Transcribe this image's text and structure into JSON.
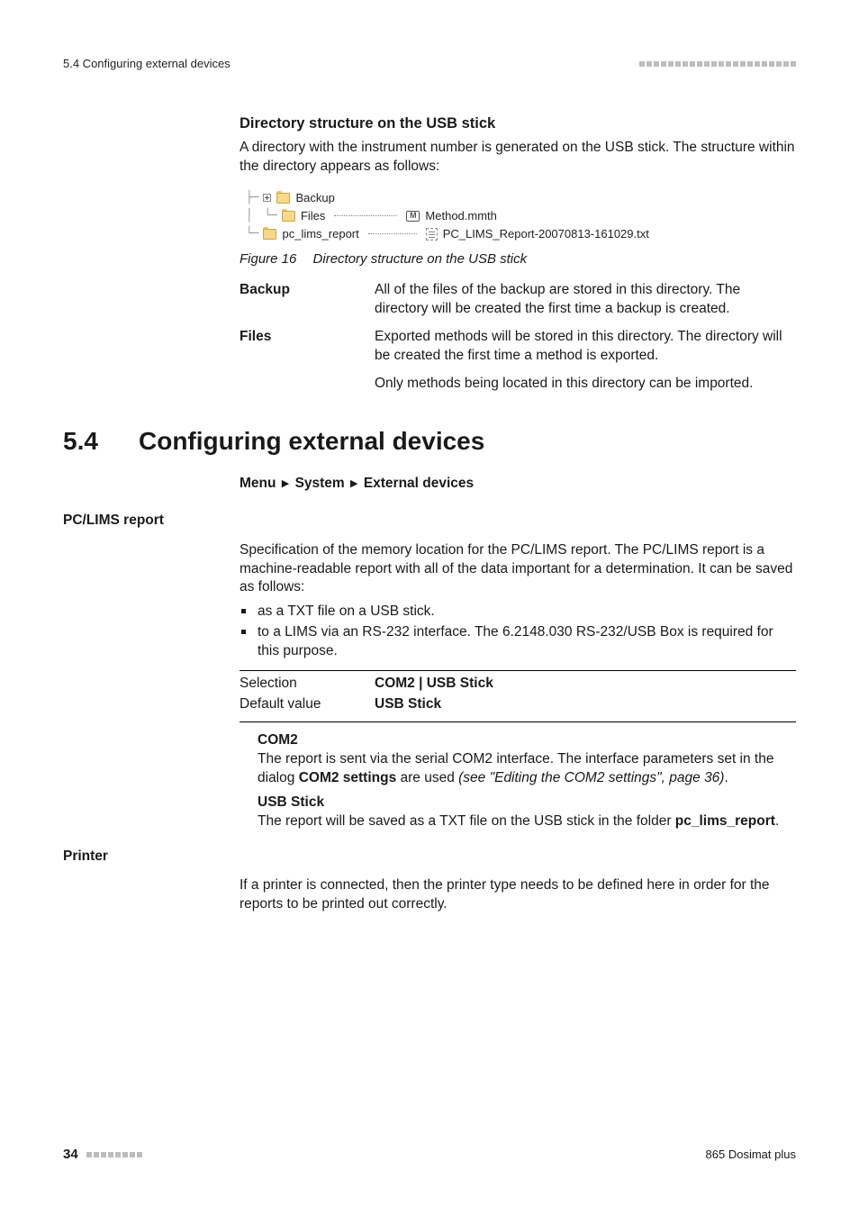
{
  "header": {
    "section_ref": "5.4 Configuring external devices"
  },
  "block1": {
    "heading": "Directory structure on the USB stick",
    "para": "A directory with the instrument number is generated on the USB stick. The structure within the directory appears as follows:",
    "tree": {
      "backup": "Backup",
      "files": "Files",
      "method": "Method.mmth",
      "pclims": "pc_lims_report",
      "report": "PC_LIMS_Report-20070813-161029.txt"
    },
    "fig_label": "Figure 16",
    "fig_caption": "Directory structure on the USB stick",
    "def_backup_term": "Backup",
    "def_backup_body": "All of the files of the backup are stored in this directory. The directory will be created the first time a backup is created.",
    "def_files_term": "Files",
    "def_files_body1": "Exported methods will be stored in this directory. The directory will be created the first time a method is exported.",
    "def_files_body2": "Only methods being located in this directory can be imported."
  },
  "section": {
    "num": "5.4",
    "title": "Configuring external devices"
  },
  "breadcrumb": {
    "a": "Menu",
    "b": "System",
    "c": "External devices"
  },
  "pclims": {
    "label": "PC/LIMS report",
    "para": "Specification of the memory location for the PC/LIMS report. The PC/LIMS report is a machine-readable report with all of the data important for a determination. It can be saved as follows:",
    "li1": "as a TXT file on a USB stick.",
    "li2": "to a LIMS via an RS-232 interface. The 6.2148.030 RS-232/USB Box is required for this purpose.",
    "selection_k": "Selection",
    "selection_v": "COM2 | USB Stick",
    "default_k": "Default value",
    "default_v": "USB Stick",
    "com2_lead": "COM2",
    "com2_body_a": "The report is sent via the serial COM2 interface. The interface parameters set in the dialog ",
    "com2_body_bold": "COM2 settings",
    "com2_body_b": " are used ",
    "com2_xref": "(see \"Editing the COM2 settings\", page 36)",
    "com2_body_c": ".",
    "usb_lead": "USB Stick",
    "usb_body_a": "The report will be saved as a TXT file on the USB stick in the folder ",
    "usb_body_bold": "pc_lims_report",
    "usb_body_b": "."
  },
  "printer": {
    "label": "Printer",
    "para": "If a printer is connected, then the printer type needs to be defined here in order for the reports to be printed out correctly."
  },
  "footer": {
    "page": "34",
    "product": "865 Dosimat plus"
  }
}
